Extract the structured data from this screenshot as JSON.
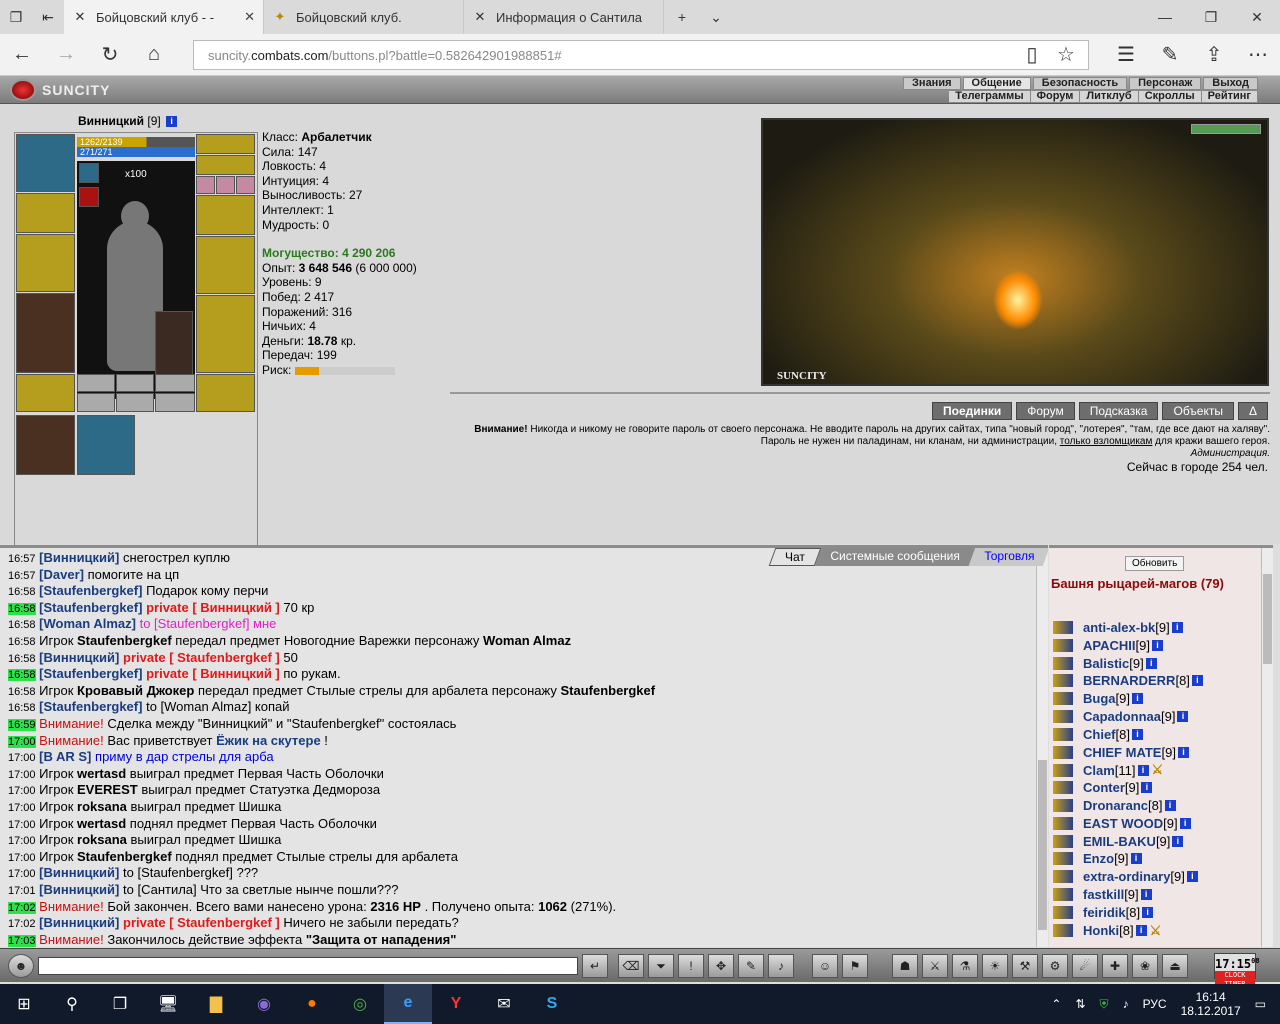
{
  "browser": {
    "tabs": [
      {
        "title": "Бойцовский клуб - -",
        "active": true
      },
      {
        "title": "Бойцовский клуб.",
        "active": false
      },
      {
        "title": "Информация о Сантила",
        "active": false
      }
    ],
    "url_prefix": "suncity.",
    "url_domain": "combats.com",
    "url_rest": "/buttons.pl?battle=0.582642901988851#"
  },
  "game": {
    "logo": "SUNCITY",
    "menu_top": [
      "Знания",
      "Общение",
      "Безопасность",
      "Персонаж",
      "Выход"
    ],
    "menu_top_selected": "Общение",
    "menu_sub": [
      "Телеграммы",
      "Форум",
      "Литклуб",
      "Скроллы",
      "Рейтинг"
    ]
  },
  "character": {
    "name": "Винницкий",
    "level": "[9]",
    "hp": "1262/2139",
    "mp": "271/271",
    "item_count": "x100",
    "hp_fraction": 0.59,
    "stats": {
      "class_label": "Класс:",
      "class_value": "Арбалетчик",
      "str": "Сила: 147",
      "agi": "Ловкость: 4",
      "int": "Интуиция: 4",
      "end": "Выносливость: 27",
      "intel": "Интеллект: 1",
      "wis": "Мудрость: 0",
      "power_label": "Могущество:",
      "power_value": "4 290 206",
      "exp_label": "Опыт:",
      "exp_value": "3 648 546",
      "exp_next": "(6 000 000)",
      "level": "Уровень: 9",
      "wins": "Побед: 2 417",
      "losses": "Поражений: 316",
      "draws": "Ничьих: 4",
      "money_label": "Деньги:",
      "money_value": "18.78",
      "money_unit": "кр.",
      "transfers": "Передач: 199",
      "risk_label": "Риск:",
      "risk_fraction": 0.24
    }
  },
  "scene": {
    "label": "SUNCITY"
  },
  "buttons": [
    "Поединки",
    "Форум",
    "Подсказка",
    "Объекты",
    "Δ"
  ],
  "warning": {
    "bold": "Внимание!",
    "text1": " Никогда и никому не говорите пароль от своего персонажа. Не вводите пароль на других сайтах, типа \"новый город\", \"лотерея\", \"там, где все дают на халяву\". Пароль не нужен ни паладинам, ни кланам, ни администрации, ",
    "link": "только взломщикам",
    "text2": " для кражи вашего героя.",
    "sign": "Администрация."
  },
  "online": "Сейчас в городе 254 чел.",
  "chat": {
    "tabs": [
      "Чат",
      "Системные сообщения",
      "Торговля"
    ],
    "messages": [
      {
        "t": "16:57",
        "hl": false,
        "parts": [
          [
            "n",
            "[Винницкий]"
          ],
          [
            "",
            "снегострел куплю"
          ]
        ]
      },
      {
        "t": "16:57",
        "hl": false,
        "parts": [
          [
            "n",
            "[Daver]"
          ],
          [
            "",
            "помогите на цп"
          ]
        ]
      },
      {
        "t": "16:58",
        "hl": false,
        "parts": [
          [
            "n",
            "[Staufenbergkef]"
          ],
          [
            "",
            "Подарок кому перчи"
          ]
        ]
      },
      {
        "t": "16:58",
        "hl": true,
        "parts": [
          [
            "n",
            "[Staufenbergkef]"
          ],
          [
            "p",
            "private [ Винницкий ]"
          ],
          [
            "",
            "70 кр"
          ]
        ]
      },
      {
        "t": "16:58",
        "hl": false,
        "parts": [
          [
            "n",
            "[Woman Almaz]"
          ],
          [
            "pink",
            "to [Staufenbergkef] мне"
          ]
        ]
      },
      {
        "t": "16:58",
        "hl": false,
        "parts": [
          [
            "",
            "Игрок"
          ],
          [
            "b",
            "Staufenbergkef"
          ],
          [
            "",
            "передал предмет Новогодние Варежки персонажу"
          ],
          [
            "b",
            "Woman Almaz"
          ]
        ]
      },
      {
        "t": "16:58",
        "hl": false,
        "parts": [
          [
            "n",
            "[Винницкий]"
          ],
          [
            "p",
            "private [ Staufenbergkef ]"
          ],
          [
            "",
            "50"
          ]
        ]
      },
      {
        "t": "16:58",
        "hl": true,
        "parts": [
          [
            "n",
            "[Staufenbergkef]"
          ],
          [
            "p",
            "private [ Винницкий ]"
          ],
          [
            "",
            "по рукам."
          ]
        ]
      },
      {
        "t": "16:58",
        "hl": false,
        "parts": [
          [
            "",
            "Игрок"
          ],
          [
            "b",
            "Кровавый Джокер"
          ],
          [
            "",
            "передал предмет Стылые стрелы для арбалета персонажу"
          ],
          [
            "b",
            "Staufenbergkef"
          ]
        ]
      },
      {
        "t": "16:58",
        "hl": false,
        "parts": [
          [
            "n",
            "[Staufenbergkef]"
          ],
          [
            "",
            "to [Woman Almaz] копай"
          ]
        ]
      },
      {
        "t": "16:59",
        "hl": true,
        "parts": [
          [
            "warn",
            "Внимание!"
          ],
          [
            "",
            "Сделка между \"Винницкий\" и \"Staufenbergkef\" состоялась"
          ]
        ]
      },
      {
        "t": "17:00",
        "hl": true,
        "parts": [
          [
            "warn",
            "Внимание!"
          ],
          [
            "",
            "Вас приветствует"
          ],
          [
            "n",
            "Ёжик на скутере"
          ],
          [
            "",
            "!"
          ]
        ]
      },
      {
        "t": "17:00",
        "hl": false,
        "parts": [
          [
            "n",
            "[B AR S]"
          ],
          [
            "bl",
            "приму в дар стрелы для арба"
          ]
        ]
      },
      {
        "t": "17:00",
        "hl": false,
        "parts": [
          [
            "",
            "Игрок"
          ],
          [
            "b",
            "wertasd"
          ],
          [
            "",
            "выиграл предмет Первая Часть Оболочки"
          ]
        ]
      },
      {
        "t": "17:00",
        "hl": false,
        "parts": [
          [
            "",
            "Игрок"
          ],
          [
            "b",
            "EVEREST"
          ],
          [
            "",
            "выиграл предмет Статуэтка Дедмороза"
          ]
        ]
      },
      {
        "t": "17:00",
        "hl": false,
        "parts": [
          [
            "",
            "Игрок"
          ],
          [
            "b",
            "roksana"
          ],
          [
            "",
            "выиграл предмет Шишка"
          ]
        ]
      },
      {
        "t": "17:00",
        "hl": false,
        "parts": [
          [
            "",
            "Игрок"
          ],
          [
            "b",
            "wertasd"
          ],
          [
            "",
            "поднял предмет Первая Часть Оболочки"
          ]
        ]
      },
      {
        "t": "17:00",
        "hl": false,
        "parts": [
          [
            "",
            "Игрок"
          ],
          [
            "b",
            "roksana"
          ],
          [
            "",
            "выиграл предмет Шишка"
          ]
        ]
      },
      {
        "t": "17:00",
        "hl": false,
        "parts": [
          [
            "",
            "Игрок"
          ],
          [
            "b",
            "Staufenbergkef"
          ],
          [
            "",
            "поднял предмет Стылые стрелы для арбалета"
          ]
        ]
      },
      {
        "t": "17:00",
        "hl": false,
        "parts": [
          [
            "n",
            "[Винницкий]"
          ],
          [
            "",
            "to [Staufenbergkef] ???"
          ]
        ]
      },
      {
        "t": "17:01",
        "hl": false,
        "parts": [
          [
            "n",
            "[Винницкий]"
          ],
          [
            "",
            "to [Сантила] Что за светлые нынче пошли???"
          ]
        ]
      },
      {
        "t": "17:02",
        "hl": true,
        "parts": [
          [
            "warn",
            "Внимание!"
          ],
          [
            "",
            "Бой закончен. Всего вами нанесено урона:"
          ],
          [
            "b",
            "2316 HP"
          ],
          [
            "",
            ". Получено опыта:"
          ],
          [
            "b",
            "1062"
          ],
          [
            "",
            "(271%)."
          ]
        ]
      },
      {
        "t": "17:02",
        "hl": false,
        "parts": [
          [
            "n",
            "[Винницкий]"
          ],
          [
            "p",
            "private [ Staufenbergkef ]"
          ],
          [
            "",
            "Ничего не забыли передать?"
          ]
        ]
      },
      {
        "t": "17:03",
        "hl": true,
        "parts": [
          [
            "warn",
            "Внимание!"
          ],
          [
            "",
            "Закончилось действие эффекта"
          ],
          [
            "b",
            "\"Защита от нападения\""
          ]
        ]
      }
    ]
  },
  "room": {
    "refresh": "Обновить",
    "name": "Башня рыцарей-магов (79)",
    "players": [
      {
        "n": "anti-alex-bk",
        "l": "[9]",
        "x": false
      },
      {
        "n": "APACHII",
        "l": "[9]",
        "x": false
      },
      {
        "n": "Balistic",
        "l": "[9]",
        "x": false
      },
      {
        "n": "BERNARDERR",
        "l": "[8]",
        "x": false
      },
      {
        "n": "Buga",
        "l": "[9]",
        "x": false
      },
      {
        "n": "Capadonnaa",
        "l": "[9]",
        "x": false
      },
      {
        "n": "Chief",
        "l": "[8]",
        "x": false
      },
      {
        "n": "CHIEF MATE",
        "l": "[9]",
        "x": false
      },
      {
        "n": "Clam",
        "l": "[11]",
        "x": true
      },
      {
        "n": "Conter",
        "l": "[9]",
        "x": false
      },
      {
        "n": "Dronaranc",
        "l": "[8]",
        "x": false
      },
      {
        "n": "EAST WOOD",
        "l": "[9]",
        "x": false
      },
      {
        "n": "EMIL-BAKU",
        "l": "[9]",
        "x": false
      },
      {
        "n": "Enzo",
        "l": "[9]",
        "x": false
      },
      {
        "n": "extra-ordinary",
        "l": "[9]",
        "x": false
      },
      {
        "n": "fastkill",
        "l": "[9]",
        "x": false
      },
      {
        "n": "feiridik",
        "l": "[8]",
        "x": false
      },
      {
        "n": "Honki",
        "l": "[8]",
        "x": true
      }
    ]
  },
  "clock": {
    "time": "17:15",
    "sec": "08",
    "label1": "CLOCK",
    "label2": "TIMER"
  },
  "taskbar": {
    "lang": "РУС",
    "time": "16:14",
    "date": "18.12.2017"
  }
}
